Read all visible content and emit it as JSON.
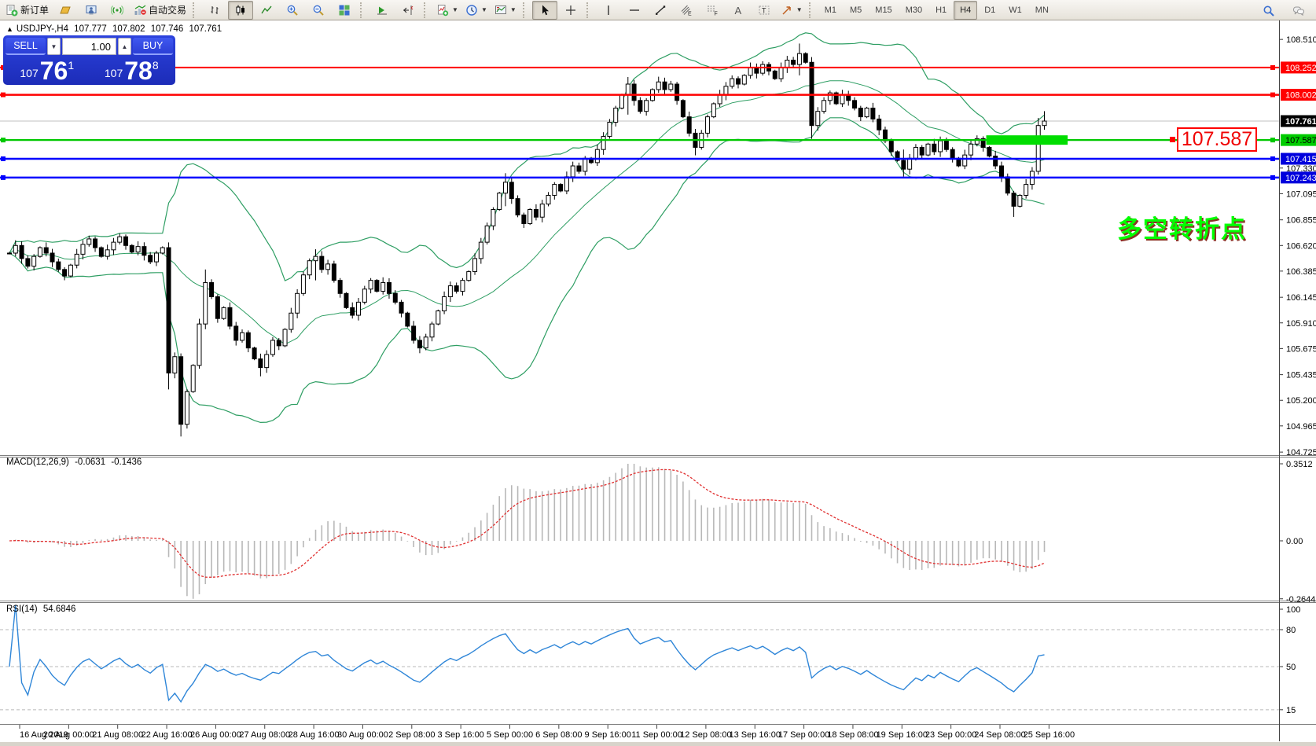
{
  "toolbar": {
    "new_order_label": "新订单",
    "auto_trading_label": "自动交易",
    "icons": [
      "new-order-icon",
      "history-icon",
      "profile-icon",
      "signal-icon",
      "auto-trading-icon",
      "bar-chart-icon",
      "candlestick-icon",
      "line-chart-icon",
      "zoom-in-icon",
      "zoom-out-icon",
      "tile-windows-icon",
      "auto-scroll-icon",
      "chart-shift-icon",
      "indicators-icon",
      "periods-icon",
      "templates-icon",
      "cursor-icon",
      "crosshair-icon",
      "vertical-line-icon",
      "horizontal-line-icon",
      "trendline-icon",
      "channel-icon",
      "fibonacci-icon",
      "text-icon",
      "text-label-icon",
      "arrows-icon",
      "search-icon",
      "chat-icon"
    ],
    "timeframes": {
      "items": [
        "M1",
        "M5",
        "M15",
        "M30",
        "H1",
        "H4",
        "D1",
        "W1",
        "MN"
      ],
      "active": "H4"
    }
  },
  "ohlc": {
    "symbol_tf": "USDJPY-,H4",
    "open": "107.777",
    "high": "107.802",
    "low": "107.746",
    "close": "107.761"
  },
  "trade_panel": {
    "sell_label": "SELL",
    "buy_label": "BUY",
    "volume": "1.00",
    "sell_price": {
      "prefix": "107",
      "big": "76",
      "sup": "1"
    },
    "buy_price": {
      "prefix": "107",
      "big": "78",
      "sup": "8"
    }
  },
  "panes": {
    "macd": {
      "name": "MACD(12,26,9)",
      "value_main": "-0.0631",
      "value_signal": "-0.1436"
    },
    "rsi": {
      "name": "RSI(14)",
      "value": "54.6846"
    }
  },
  "annotations": {
    "price_box": {
      "text": "107.587"
    },
    "turning_point": {
      "text": "多空转折点",
      "color": "#00ff00"
    }
  },
  "chart_data": {
    "type": "candlestick",
    "symbol": "USDJPY",
    "timeframe": "H4",
    "closes": [
      106.55,
      106.62,
      106.5,
      106.43,
      106.52,
      106.6,
      106.55,
      106.47,
      106.4,
      106.34,
      106.44,
      106.54,
      106.63,
      106.68,
      106.6,
      106.52,
      106.58,
      106.65,
      106.7,
      106.62,
      106.56,
      106.61,
      106.53,
      106.47,
      106.55,
      106.6,
      105.45,
      105.6,
      104.98,
      105.28,
      105.52,
      105.9,
      106.28,
      106.15,
      105.95,
      106.05,
      105.88,
      105.75,
      105.82,
      105.68,
      105.58,
      105.5,
      105.62,
      105.75,
      105.7,
      105.85,
      106.0,
      106.18,
      106.35,
      106.48,
      106.52,
      106.4,
      106.45,
      106.3,
      106.18,
      106.05,
      105.98,
      106.1,
      106.22,
      106.3,
      106.2,
      106.28,
      106.18,
      106.1,
      106.0,
      105.88,
      105.75,
      105.68,
      105.78,
      105.9,
      106.02,
      106.15,
      106.25,
      106.2,
      106.3,
      106.38,
      106.5,
      106.65,
      106.8,
      106.95,
      107.1,
      107.2,
      107.05,
      106.9,
      106.82,
      106.95,
      106.88,
      107.0,
      107.08,
      107.18,
      107.12,
      107.25,
      107.35,
      107.3,
      107.42,
      107.38,
      107.5,
      107.62,
      107.75,
      107.88,
      108.0,
      108.1,
      107.95,
      107.85,
      107.95,
      108.05,
      108.12,
      108.05,
      108.1,
      107.95,
      107.8,
      107.65,
      107.52,
      107.65,
      107.8,
      107.92,
      108.0,
      108.08,
      108.15,
      108.1,
      108.18,
      108.25,
      108.2,
      108.28,
      108.22,
      108.15,
      108.25,
      108.32,
      108.28,
      108.38,
      108.3,
      107.72,
      107.85,
      107.95,
      108.02,
      107.92,
      108.0,
      107.95,
      107.88,
      107.8,
      107.88,
      107.78,
      107.68,
      107.58,
      107.48,
      107.4,
      107.32,
      107.42,
      107.52,
      107.45,
      107.55,
      107.48,
      107.58,
      107.5,
      107.42,
      107.35,
      107.45,
      107.55,
      107.6,
      107.52,
      107.44,
      107.35,
      107.25,
      107.1,
      106.98,
      107.08,
      107.18,
      107.3,
      107.72,
      107.761
    ],
    "wick_overrides": {
      "26": [
        106.64,
        105.3
      ],
      "28": [
        105.35,
        104.868
      ],
      "32": [
        106.4,
        105.86
      ],
      "41": [
        105.6,
        105.42
      ],
      "50": [
        106.585,
        106.3
      ],
      "81": [
        107.283,
        106.98
      ],
      "101": [
        108.165,
        107.82
      ],
      "112": [
        107.68,
        107.447
      ],
      "129": [
        108.472,
        108.18
      ],
      "131": [
        108.33,
        107.598
      ],
      "146": [
        107.5,
        107.252
      ],
      "164": [
        107.12,
        106.882
      ],
      "168": [
        107.79,
        107.27
      ],
      "169": [
        107.852,
        107.71
      ]
    },
    "indicators": {
      "bollinger": {
        "period": 20,
        "deviation": 2,
        "color": "#2e9e63"
      },
      "macd": {
        "fast": 12,
        "slow": 26,
        "signal": 9,
        "hist_color": "#b8b8b8",
        "signal_color": "#e03030"
      },
      "rsi": {
        "period": 14,
        "color": "#2f86d8",
        "levels": [
          80,
          50,
          15
        ]
      }
    },
    "price_axis_ticks": [
      {
        "v": 108.51,
        "label": "108.510"
      },
      {
        "v": 107.33,
        "label": "107.330"
      },
      {
        "v": 107.095,
        "label": "107.095"
      },
      {
        "v": 106.855,
        "label": "106.855"
      },
      {
        "v": 106.62,
        "label": "106.620"
      },
      {
        "v": 106.385,
        "label": "106.385"
      },
      {
        "v": 106.145,
        "label": "106.145"
      },
      {
        "v": 105.91,
        "label": "105.910"
      },
      {
        "v": 105.675,
        "label": "105.675"
      },
      {
        "v": 105.435,
        "label": "105.435"
      },
      {
        "v": 105.2,
        "label": "105.200"
      },
      {
        "v": 104.965,
        "label": "104.965"
      },
      {
        "v": 104.725,
        "label": "104.725"
      }
    ],
    "macd_axis_ticks": [
      {
        "v": 0.3512,
        "label": "0.3512"
      },
      {
        "v": 0,
        "label": "0.00"
      },
      {
        "v": -0.2644,
        "label": "-0.2644"
      }
    ],
    "rsi_axis_ticks": [
      {
        "v": 100,
        "label": "100"
      },
      {
        "v": 80,
        "label": "80"
      },
      {
        "v": 50,
        "label": "50"
      },
      {
        "v": 15,
        "label": "15"
      }
    ],
    "hlines": [
      {
        "price": 108.252,
        "color": "#ff0000",
        "width": 2,
        "label": "108.252",
        "label_bg": "#ff0000",
        "label_fg": "#ffffff"
      },
      {
        "price": 108.002,
        "color": "#ff0000",
        "width": 2.5,
        "label": "108.002",
        "label_bg": "#ff0000",
        "label_fg": "#ffffff"
      },
      {
        "price": 107.587,
        "color": "#00c800",
        "width": 2.2,
        "label": "107.587",
        "label_bg": "#00cc00",
        "label_fg": "#000000"
      },
      {
        "price": 107.415,
        "color": "#0000ff",
        "width": 2.5,
        "label": "107.415",
        "label_bg": "#0000dd",
        "label_fg": "#ffffff"
      },
      {
        "price": 107.243,
        "color": "#0000ff",
        "width": 2.5,
        "label": "107.243",
        "label_bg": "#0000dd",
        "label_fg": "#ffffff"
      }
    ],
    "current_price": {
      "value": 107.761,
      "label": "107.761",
      "line_color": "#c0c0c0",
      "label_bg": "#000000",
      "label_fg": "#ffffff"
    },
    "highlight_rect": {
      "price": 107.587,
      "from_bar": 159.5,
      "to_bar": 172.8,
      "color": "#00dd00",
      "half_height": 6
    },
    "time_labels": [
      "16 Aug 2019",
      "20 Aug 00:00",
      "21 Aug 08:00",
      "22 Aug 16:00",
      "26 Aug 00:00",
      "27 Aug 08:00",
      "28 Aug 16:00",
      "30 Aug 00:00",
      "2 Sep 08:00",
      "3 Sep 16:00",
      "5 Sep 00:00",
      "6 Sep 08:00",
      "9 Sep 16:00",
      "11 Sep 00:00",
      "12 Sep 08:00",
      "13 Sep 16:00",
      "17 Sep 00:00",
      "18 Sep 08:00",
      "19 Sep 16:00",
      "23 Sep 00:00",
      "24 Sep 08:00",
      "25 Sep 16:00"
    ]
  }
}
